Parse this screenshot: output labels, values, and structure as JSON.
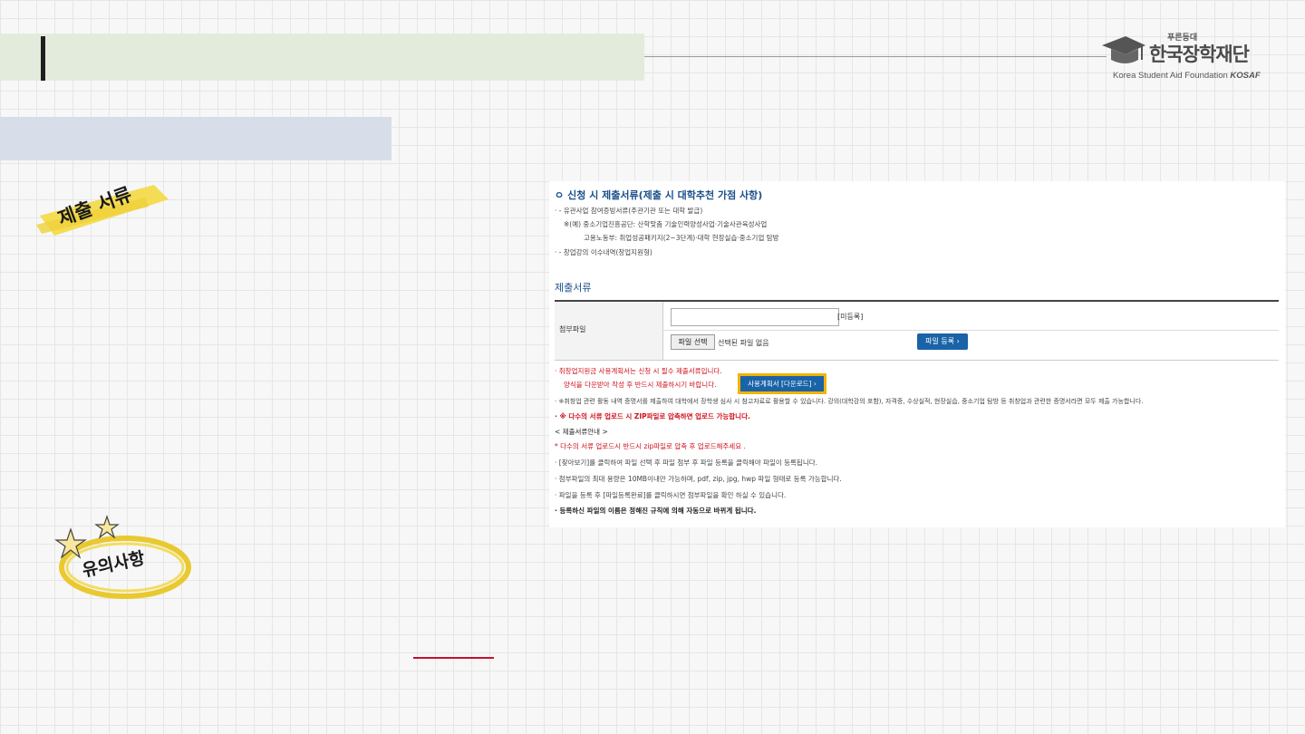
{
  "logo": {
    "small_text": "푸른등대",
    "main_text": "한국장학재단",
    "english_text": "Korea Student Aid Foundation",
    "english_bold": "KOSAF"
  },
  "stickers": {
    "documents": "제출 서류",
    "cautions": "유의사항"
  },
  "panel": {
    "heading": "신청 시 제출서류(제출 시 대학추천 가점 사항)",
    "lines": [
      "·  - 유관사업 참여증빙서류(주관기관 또는 대학 발급)",
      "※(예) 중소기업진흥공단: 산학맞춤 기술인력양성사업·기술사관육성사업",
      "고용노동부: 취업성공패키지(2~3단계)·대학 현장실습·중소기업 탐방",
      "·  - 창업강의 이수내역(창업지원형)"
    ],
    "section_title": "제출서류",
    "table": {
      "header": "첨부파일",
      "input_value": "",
      "unregistered": "[미등록]",
      "file_button": "파일 선택",
      "no_file": "선택된 파일 없음",
      "register_button": "파일 등록 ›"
    },
    "notice_red1": "·  취창업지원금 사용계획서는 신청 시 필수 제출서류입니다.",
    "notice_red2": "양식을 다운받아 작성 후 반드시 제출하시기 바랍니다.",
    "download_button": "사용계획서 [다운로드] ›",
    "notice_gray": "·  ※취창업 관련 활동 내역 증명서를 제출하여 대학에서 장학생 심사 시 참고자료로 활용할 수 있습니다. 강의(대학강의 포함), 자격증, 수상실적, 현장실습, 중소기업 탐방 등 취창업과 관련한 증명서라면 모두 제출 가능합니다.",
    "notice_red3": "·  ※ 다수의 서류 업로드 시 ZIP파일로 압축하면 업로드 가능합니다.",
    "guide_title": "< 제출서류안내 >",
    "guide_red": "* 다수의 서류 업로드시 반드시 zip파일로 압축 후 업로드해주세요 .",
    "guide_lines": [
      "·  [찾아보기]를 클릭하여 파일 선택 후 파일 첨부 후 파일 등록을 클릭해야 파일이 등록됩니다.",
      "·  첨부파일의 최대 용량은 10MB이내만 가능하며, pdf, zip, jpg, hwp 파일 형태로 등록 가능합니다.",
      "·  파일을 등록 후 [파일등록완료]를 클릭하시면 첨부파일을 확인 하실 수 있습니다."
    ],
    "guide_bold": "·  등록하신 파일의 이름은 정해진 규칙에 의해 자동으로 바뀌게 됩니다."
  }
}
